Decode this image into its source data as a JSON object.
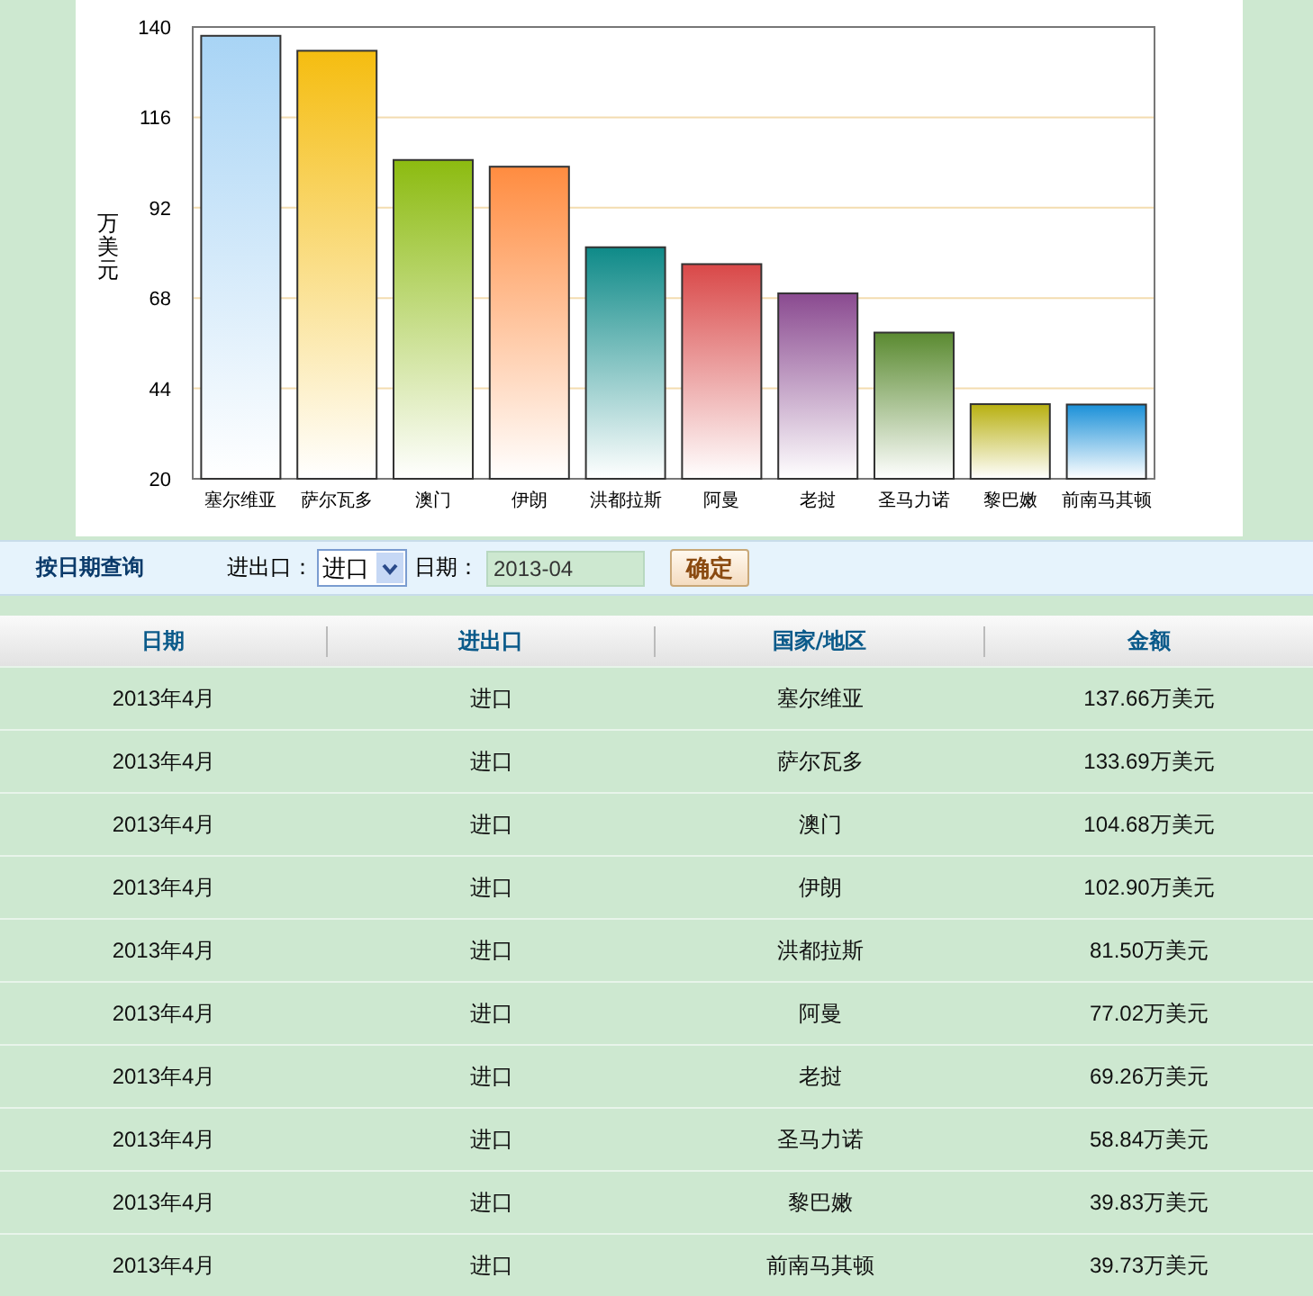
{
  "chart": {
    "chart_data": {
      "type": "bar",
      "ylabel": "万美元",
      "categories": [
        "塞尔维亚",
        "萨尔瓦多",
        "澳门",
        "伊朗",
        "洪都拉斯",
        "阿曼",
        "老挝",
        "圣马力诺",
        "黎巴嫩",
        "前南马其顿"
      ],
      "grid": true,
      "series": [
        {
          "values": [
            137.66,
            133.69,
            104.68,
            102.9,
            81.5,
            77.02,
            69.26,
            58.84,
            39.83,
            39.73
          ]
        }
      ],
      "colors": [
        "#a8d4f5",
        "#f5bd10",
        "#8cbb10",
        "#ff8c40",
        "#0e8a88",
        "#d94848",
        "#8a4a90",
        "#5a8a30",
        "#b8b010",
        "#1a90d8"
      ],
      "ylim": [
        20,
        140
      ],
      "yticks": [
        20,
        44,
        68,
        92,
        116,
        140
      ]
    }
  },
  "query": {
    "title": "按日期查询",
    "type_label": "进出口：",
    "type_value": "进口",
    "date_label": "日期：",
    "date_value": "2013-04",
    "submit": "确定"
  },
  "table": {
    "columns": [
      "日期",
      "进出口",
      "国家/地区",
      "金额"
    ],
    "rows": [
      [
        "2013年4月",
        "进口",
        "塞尔维亚",
        "137.66万美元"
      ],
      [
        "2013年4月",
        "进口",
        "萨尔瓦多",
        "133.69万美元"
      ],
      [
        "2013年4月",
        "进口",
        "澳门",
        "104.68万美元"
      ],
      [
        "2013年4月",
        "进口",
        "伊朗",
        "102.90万美元"
      ],
      [
        "2013年4月",
        "进口",
        "洪都拉斯",
        "81.50万美元"
      ],
      [
        "2013年4月",
        "进口",
        "阿曼",
        "77.02万美元"
      ],
      [
        "2013年4月",
        "进口",
        "老挝",
        "69.26万美元"
      ],
      [
        "2013年4月",
        "进口",
        "圣马力诺",
        "58.84万美元"
      ],
      [
        "2013年4月",
        "进口",
        "黎巴嫩",
        "39.83万美元"
      ],
      [
        "2013年4月",
        "进口",
        "前南马其顿",
        "39.73万美元"
      ]
    ]
  }
}
